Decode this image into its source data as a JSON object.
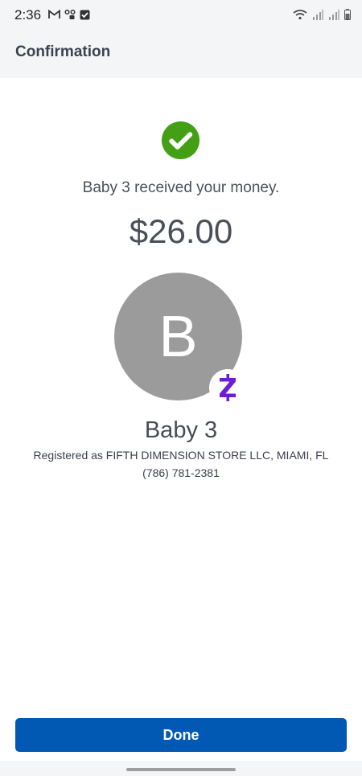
{
  "status_bar": {
    "time": "2:36",
    "left_icons": [
      "gmail-icon",
      "voicemail-icon",
      "checkbox-icon"
    ],
    "right_icons": [
      "wifi-icon",
      "signal-icon",
      "signal-icon",
      "battery-icon"
    ]
  },
  "header": {
    "title": "Confirmation"
  },
  "confirmation": {
    "message": "Baby 3 received your money.",
    "amount": "$26.00",
    "status_color": "#43a014"
  },
  "recipient": {
    "initial": "B",
    "name": "Baby 3",
    "registered": "Registered as FIFTH DIMENSION STORE LLC, MIAMI, FL",
    "phone": "(786) 781-2381",
    "avatar_color": "#9b9b9b",
    "badge_icon": "zelle-icon",
    "badge_color": "#6d1ed4"
  },
  "actions": {
    "done_label": "Done",
    "accent": "#0159b4"
  }
}
